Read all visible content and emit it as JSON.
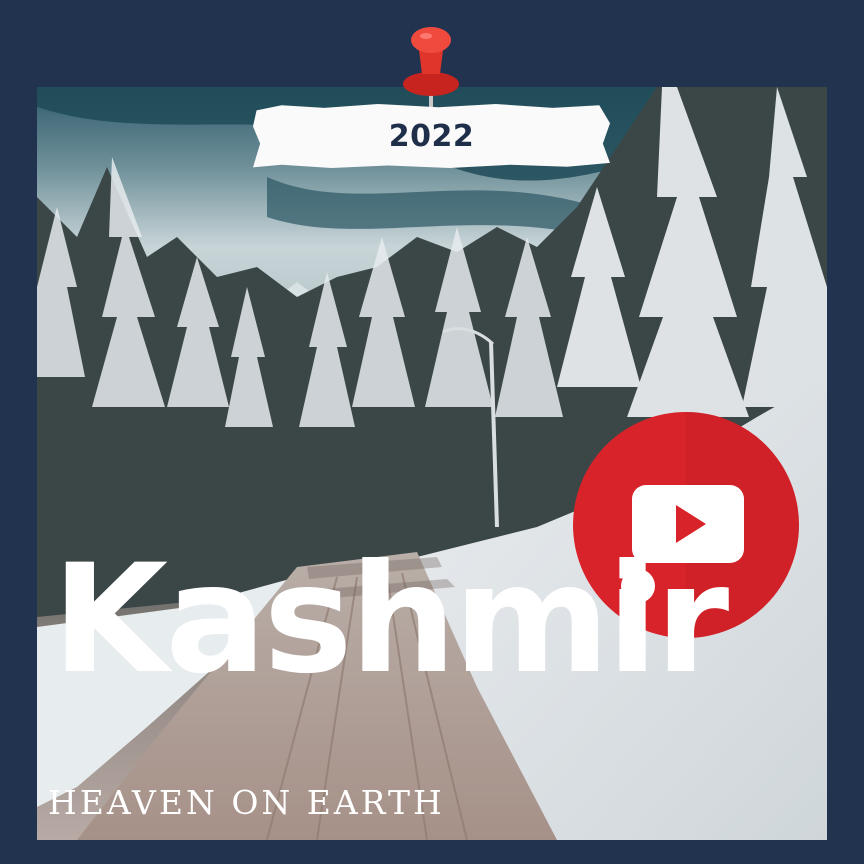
{
  "poster": {
    "year": "2022",
    "title": "Kashmir",
    "subtitle": "HEAVEN ON EARTH"
  },
  "icons": {
    "pin": "push-pin-icon",
    "video": "youtube-play-icon"
  },
  "colors": {
    "frame": "#22334f",
    "pin_red": "#e0352b",
    "badge_red": "#d9232a",
    "year_text": "#1f2f4a",
    "title_text": "#ffffff"
  }
}
